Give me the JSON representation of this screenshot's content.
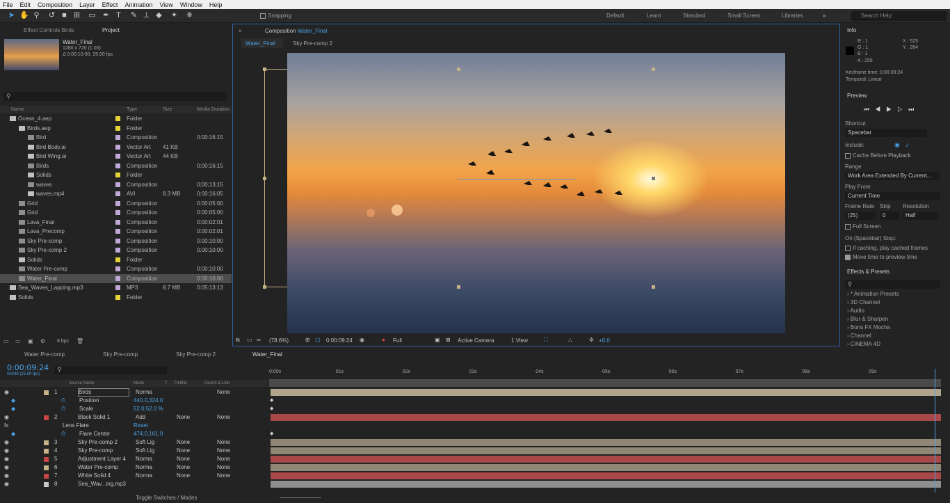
{
  "menu": [
    "File",
    "Edit",
    "Composition",
    "Layer",
    "Effect",
    "Animation",
    "View",
    "Window",
    "Help"
  ],
  "toolbar": {
    "snapping_label": "Snapping",
    "workspaces": [
      "Default",
      "Learn",
      "Standard",
      "Small Screen",
      "Libraries"
    ],
    "search_placeholder": "Search Help"
  },
  "project": {
    "tabs": [
      "Effect Controls Birds",
      "Project"
    ],
    "selected": {
      "name": "Water_Final",
      "dims": "1280 x 720 (1.00)",
      "duration": "Δ 0:00:10:00, 25.00 fps"
    },
    "columns": [
      "Name",
      "Type",
      "Size",
      "Media Duration"
    ],
    "items": [
      {
        "name": "Ocean_4.aep",
        "type": "Folder",
        "size": "",
        "dur": "",
        "indent": 0,
        "color": "#e6d23a"
      },
      {
        "name": "Birds.aep",
        "type": "Folder",
        "size": "",
        "dur": "",
        "indent": 1,
        "color": "#e6d23a"
      },
      {
        "name": "Bird",
        "type": "Composition",
        "size": "",
        "dur": "0:00:16:15",
        "indent": 2,
        "color": "#c0a8d8"
      },
      {
        "name": "Bird Body.ai",
        "type": "Vector Art",
        "size": "41 KB",
        "dur": "",
        "indent": 2,
        "color": "#c0a8d8"
      },
      {
        "name": "Bird Wing.ai",
        "type": "Vector Art",
        "size": "44 KB",
        "dur": "",
        "indent": 2,
        "color": "#c0a8d8"
      },
      {
        "name": "Birds",
        "type": "Composition",
        "size": "",
        "dur": "0:00:16:15",
        "indent": 2,
        "color": "#c0a8d8"
      },
      {
        "name": "Solids",
        "type": "Folder",
        "size": "",
        "dur": "",
        "indent": 2,
        "color": "#e6d23a"
      },
      {
        "name": "waves",
        "type": "Composition",
        "size": "",
        "dur": "0;00;13;15",
        "indent": 2,
        "color": "#c0a8d8"
      },
      {
        "name": "waves.mp4",
        "type": "AVI",
        "size": "8.3 MB",
        "dur": "0:00:16:05",
        "indent": 2,
        "color": "#c0a8d8"
      },
      {
        "name": "Grid",
        "type": "Composition",
        "size": "",
        "dur": "0:00:05:00",
        "indent": 1,
        "color": "#c0a8d8"
      },
      {
        "name": "Grid",
        "type": "Composition",
        "size": "",
        "dur": "0:00:05:00",
        "indent": 1,
        "color": "#c0a8d8"
      },
      {
        "name": "Lava_Final",
        "type": "Composition",
        "size": "",
        "dur": "0:00:02:01",
        "indent": 1,
        "color": "#c0a8d8"
      },
      {
        "name": "Lava_Precomp",
        "type": "Composition",
        "size": "",
        "dur": "0:00:02:01",
        "indent": 1,
        "color": "#c0a8d8"
      },
      {
        "name": "Sky Pre-comp",
        "type": "Composition",
        "size": "",
        "dur": "0:00:10:00",
        "indent": 1,
        "color": "#c0a8d8"
      },
      {
        "name": "Sky Pre-comp 2",
        "type": "Composition",
        "size": "",
        "dur": "0:00:10:00",
        "indent": 1,
        "color": "#c0a8d8"
      },
      {
        "name": "Solids",
        "type": "Folder",
        "size": "",
        "dur": "",
        "indent": 1,
        "color": "#e6d23a"
      },
      {
        "name": "Water Pre-comp",
        "type": "Composition",
        "size": "",
        "dur": "0:00:10:00",
        "indent": 1,
        "color": "#c0a8d8"
      },
      {
        "name": "Water_Final",
        "type": "Composition",
        "size": "",
        "dur": "0:00:10:00",
        "indent": 1,
        "color": "#c0a8d8",
        "selected": true
      },
      {
        "name": "Sea_Waves_Lapping.mp3",
        "type": "MP3",
        "size": "8.7 MB",
        "dur": "0:05:13:13",
        "indent": 0,
        "color": "#c0a8d8"
      },
      {
        "name": "Solids",
        "type": "Folder",
        "size": "",
        "dur": "",
        "indent": 0,
        "color": "#e6d23a"
      }
    ],
    "bpc": "8 bpc"
  },
  "composition": {
    "title_prefix": "Composition",
    "title_name": "Water_Final",
    "tabs": [
      "Water_Final",
      "Sky Pre-comp 2"
    ],
    "zoom": "(78.6%)",
    "time": "0:00:09:24",
    "resolution": "Full",
    "camera": "Active Camera",
    "view": "1 View",
    "exposure": "+0.0"
  },
  "info": {
    "title": "Info",
    "r": "R : 1",
    "g": "G : 1",
    "b": "B : 1",
    "a": "A : 255",
    "x": "X : 525",
    "y": "Y : 264",
    "keyframe_time": "Keyframe time: 0:00:09:24",
    "temporal": "Temporal: Linear"
  },
  "preview": {
    "title": "Preview",
    "shortcut_label": "Shortcut",
    "shortcut": "Spacebar",
    "include_label": "Include:",
    "cache_label": "Cache Before Playback",
    "range_label": "Range",
    "range": "Work Area Extended By Current...",
    "play_from_label": "Play From",
    "play_from": "Current Time",
    "frame_rate_label": "Frame Rate",
    "skip_label": "Skip",
    "resolution_label": "Resolution",
    "frame_rate": "(25)",
    "skip": "0",
    "resolution": "Half",
    "full_screen": "Full Screen",
    "stop_label": "On (Spacebar) Stop:",
    "if_caching": "If caching, play cached frames",
    "move_time": "Move time to preview time"
  },
  "effects": {
    "title": "Effects & Presets",
    "items": [
      "* Animation Presets",
      "3D Channel",
      "Audio",
      "Blur & Sharpen",
      "Boris FX Mocha",
      "Channel",
      "CINEMA 4D"
    ]
  },
  "timeline": {
    "tabs": [
      "Water Pre-comp",
      "Sky Pre-comp",
      "Sky Pre-comp 2",
      "Water_Final"
    ],
    "current_time": "0:00:09:24",
    "frame_info": "00249 (25.00 fps)",
    "columns": {
      "source": "Source Name",
      "mode": "Mode",
      "t": "T",
      "trkmat": "TrkMat",
      "parent": "Parent & Link"
    },
    "ruler": [
      "0:00s",
      "01s",
      "02s",
      "03s",
      "04s",
      "05s",
      "06s",
      "07s",
      "08s",
      "09s"
    ],
    "layers": [
      {
        "num": "1",
        "name": "Birds",
        "mode": "Norma",
        "trk": "",
        "parent": "None",
        "color": "#c7b187",
        "bar": "#b0a48a"
      },
      {
        "prop": "Position",
        "value": "440.0,324.0"
      },
      {
        "prop": "Scale",
        "value": "52.0,52.0 %"
      },
      {
        "num": "2",
        "name": "Black Solid 1",
        "mode": "Add",
        "trk": "None",
        "parent": "None",
        "color": "#c94545",
        "bar": "#a84848"
      },
      {
        "effect": "Lens Flare",
        "reset": "Reset"
      },
      {
        "prop": "Flare Center",
        "value": "474.0,161.0"
      },
      {
        "num": "3",
        "name": "Sky Pre-comp 2",
        "mode": "Soft Lig",
        "trk": "None",
        "parent": "None",
        "color": "#c7b187",
        "bar": "#8f8676"
      },
      {
        "num": "4",
        "name": "Sky Pre-comp",
        "mode": "Soft Lig",
        "trk": "None",
        "parent": "None",
        "color": "#c7b187",
        "bar": "#8f8676"
      },
      {
        "num": "5",
        "name": "Adjustment Layer 4",
        "mode": "Norma",
        "trk": "None",
        "parent": "None",
        "color": "#c94545",
        "bar": "#a84848"
      },
      {
        "num": "6",
        "name": "Water Pre-comp",
        "mode": "Norma",
        "trk": "None",
        "parent": "None",
        "color": "#c7b187",
        "bar": "#8f8676"
      },
      {
        "num": "7",
        "name": "White Solid 4",
        "mode": "Norma",
        "trk": "None",
        "parent": "None",
        "color": "#c94545",
        "bar": "#a84848"
      },
      {
        "num": "8",
        "name": "Sea_Wav...ing.mp3",
        "mode": "",
        "trk": "",
        "parent": "",
        "color": "#c7c7c7",
        "bar": "#8f8f8f"
      }
    ],
    "toggle_label": "Toggle Switches / Modes"
  }
}
